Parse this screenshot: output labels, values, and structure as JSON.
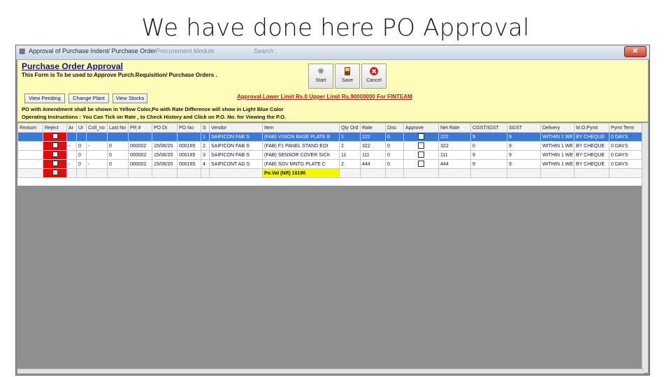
{
  "slide": {
    "title": "We have done here PO Approval"
  },
  "window": {
    "title": "Approval of Purchase Indent/ Purchase Order",
    "bg_title": "Procurement Module",
    "bg_title2": "Search : ",
    "bg_right": ""
  },
  "form": {
    "title": "Purchase Order Approval",
    "subtitle": "This Form is To be used to Approve Purch.Requisition/ Purchase Orders .",
    "toolbar": {
      "start": "Start",
      "save": "Save",
      "cancel": "Cancel"
    },
    "buttons": {
      "view_pending": "View Pending",
      "change_plant": "Change Plant",
      "view_stocks": "View Stocks"
    },
    "limit_text": "Approval Lower Limit Rs.0 Upper Limit Rs.90000000 For FINTEAM",
    "note1": "PO with Amendment shall be shown in Yellow Color,Po with Rate Difference will show in Light Blue Color",
    "note2": "Operating Instructions : You Can Tick on Rate , to Check History and Click on P.O. No. for Viewing the P.O."
  },
  "grid": {
    "headers": [
      "Reason",
      "Reject",
      "Ar",
      "Ur",
      "Coll_no",
      "Last No",
      "PR #",
      "PO Dt",
      "PO No",
      "S",
      "Vendor",
      "Item",
      "Qty Ord",
      "Rate",
      "Disc",
      "Approve",
      "Net Rate",
      "CGST/IGST",
      "SGST",
      "Delivery",
      "M.O.Pymt",
      "Pymt Term"
    ],
    "rows": [
      {
        "cells": [
          "",
          "",
          "",
          "",
          "",
          "",
          "",
          "",
          "",
          "1",
          "SAIFICON FAB S",
          "(FAB) VISION BASE PLATE B",
          "1",
          "222",
          "0",
          "",
          "222",
          "9",
          "9",
          "WITHIN 1 WE",
          "BY CHEQUE",
          "0 DAYS"
        ],
        "selected": true
      },
      {
        "cells": [
          "",
          "",
          "-",
          "0",
          "-",
          "0",
          "000002",
          "15/06/20",
          "000165",
          "2",
          "SAIFICON FAB S",
          "(FAB) F1 PANEL STAND EOI",
          "2",
          "322",
          "0",
          "",
          "322",
          "0",
          "9",
          "WITHIN 1 WE",
          "BY CHEQUE",
          "0 DAYS"
        ],
        "selected": false
      },
      {
        "cells": [
          "",
          "",
          "",
          "0",
          "",
          "0",
          "000002",
          "15/06/20",
          "000165",
          "3",
          "SAIFICON FAB S",
          "(FAB) SENSOR COVER SICK",
          "11",
          "111",
          "0",
          "",
          "111",
          "9",
          "9",
          "WITHIN 1 WE",
          "BY CHEQUE",
          "0 DAYS"
        ],
        "selected": false
      },
      {
        "cells": [
          "",
          "",
          "-",
          "0",
          "-",
          "0",
          "000002",
          "15/06/20",
          "000165",
          "4",
          "SAIFICONT AD S",
          "(FAB) SOV MNTG PLATE C",
          "2",
          "444",
          "0",
          "",
          "444",
          "9",
          "9",
          "WITHIN 1 WE",
          "BY CHEQUE",
          "0 DAYS"
        ],
        "selected": false
      }
    ],
    "total_label": "Po.Val (NR) 10190"
  },
  "colors": {
    "form_bg": "#fdfcb8",
    "reject": "#e30a0a",
    "selected": "#3a7ad6",
    "grey_area": "#8f8f8f",
    "total": "#f7f700",
    "limit": "#cc1111"
  }
}
